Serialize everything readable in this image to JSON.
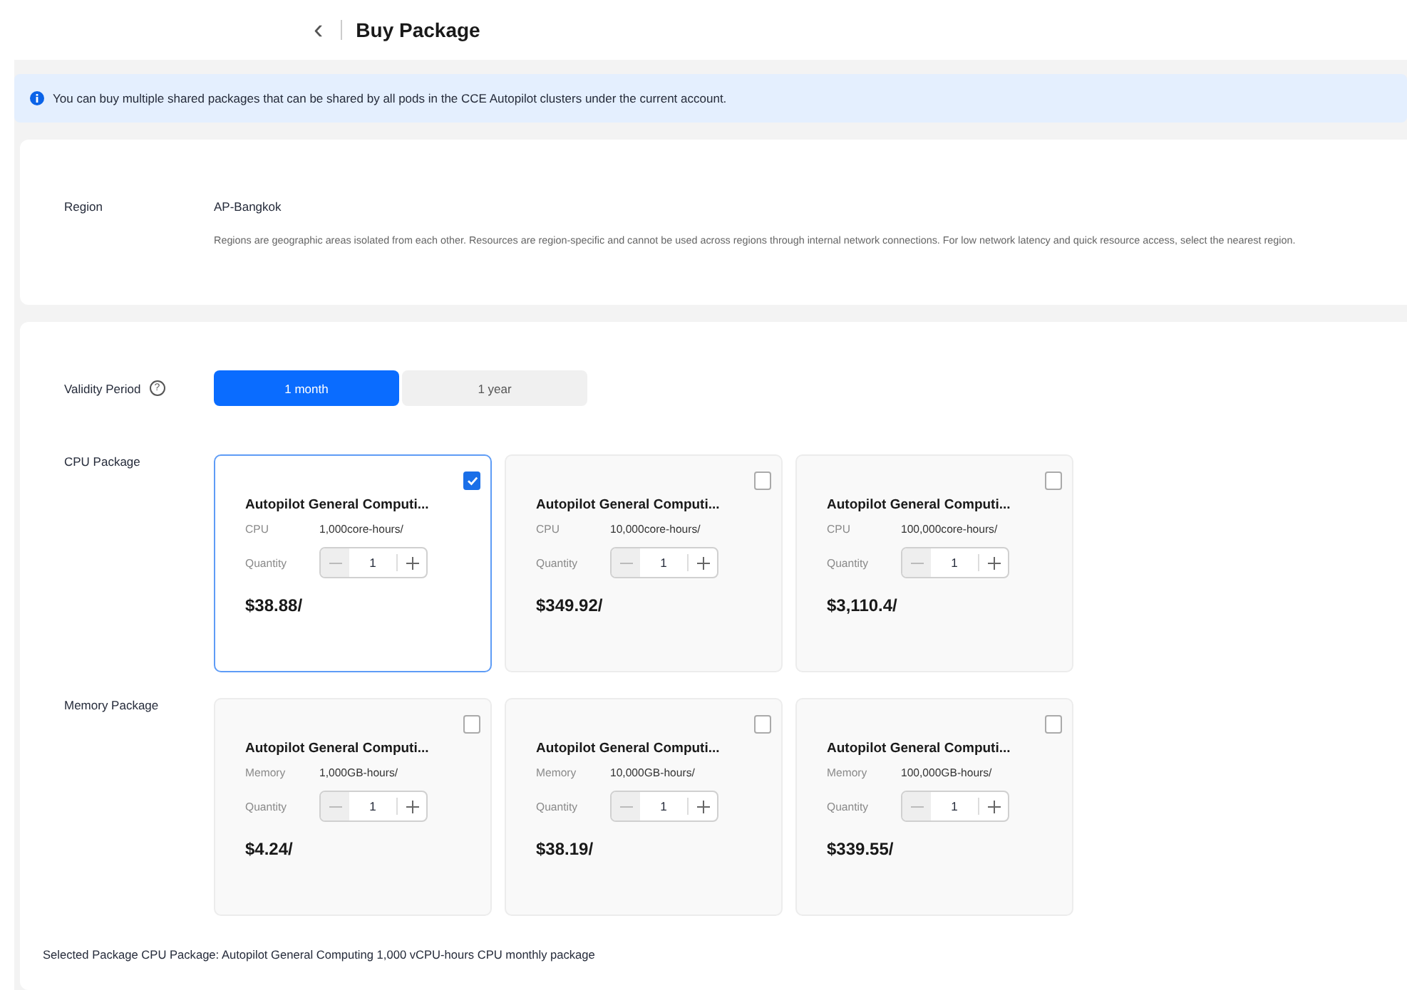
{
  "header": {
    "back": "‹",
    "title": "Buy Package"
  },
  "notice": {
    "text": "You can buy multiple shared packages that can be shared by all pods in the CCE Autopilot clusters under the current account."
  },
  "region": {
    "label": "Region",
    "value": "AP-Bangkok",
    "description": "Regions are geographic areas isolated from each other. Resources are region-specific and cannot be used across regions through internal network connections. For low network latency and quick resource access, select the nearest region."
  },
  "validity": {
    "label": "Validity Period",
    "help": "?",
    "options": [
      {
        "label": "1 month",
        "selected": true
      },
      {
        "label": "1 year",
        "selected": false
      }
    ]
  },
  "package_groups": [
    {
      "label": "CPU Package",
      "packages": [
        {
          "title": "Autopilot General Computi...",
          "spec_label": "CPU",
          "spec_value": "1,000core-hours/",
          "quantity_label": "Quantity",
          "quantity": "1",
          "decrement_disabled": true,
          "price": "$38.88/",
          "selected": true
        },
        {
          "title": "Autopilot General Computi...",
          "spec_label": "CPU",
          "spec_value": "10,000core-hours/",
          "quantity_label": "Quantity",
          "quantity": "1",
          "decrement_disabled": true,
          "price": "$349.92/",
          "selected": false
        },
        {
          "title": "Autopilot General Computi...",
          "spec_label": "CPU",
          "spec_value": "100,000core-hours/",
          "quantity_label": "Quantity",
          "quantity": "1",
          "decrement_disabled": true,
          "price": "$3,110.4/",
          "selected": false
        }
      ]
    },
    {
      "label": "Memory Package",
      "packages": [
        {
          "title": "Autopilot General Computi...",
          "spec_label": "Memory",
          "spec_value": "1,000GB-hours/",
          "quantity_label": "Quantity",
          "quantity": "1",
          "decrement_disabled": true,
          "price": "$4.24/",
          "selected": false
        },
        {
          "title": "Autopilot General Computi...",
          "spec_label": "Memory",
          "spec_value": "10,000GB-hours/",
          "quantity_label": "Quantity",
          "quantity": "1",
          "decrement_disabled": true,
          "price": "$38.19/",
          "selected": false
        },
        {
          "title": "Autopilot General Computi...",
          "spec_label": "Memory",
          "spec_value": "100,000GB-hours/",
          "quantity_label": "Quantity",
          "quantity": "1",
          "decrement_disabled": true,
          "price": "$339.55/",
          "selected": false
        }
      ]
    }
  ],
  "summary": "Selected Package CPU Package: Autopilot General Computing 1,000 vCPU-hours CPU monthly package"
}
